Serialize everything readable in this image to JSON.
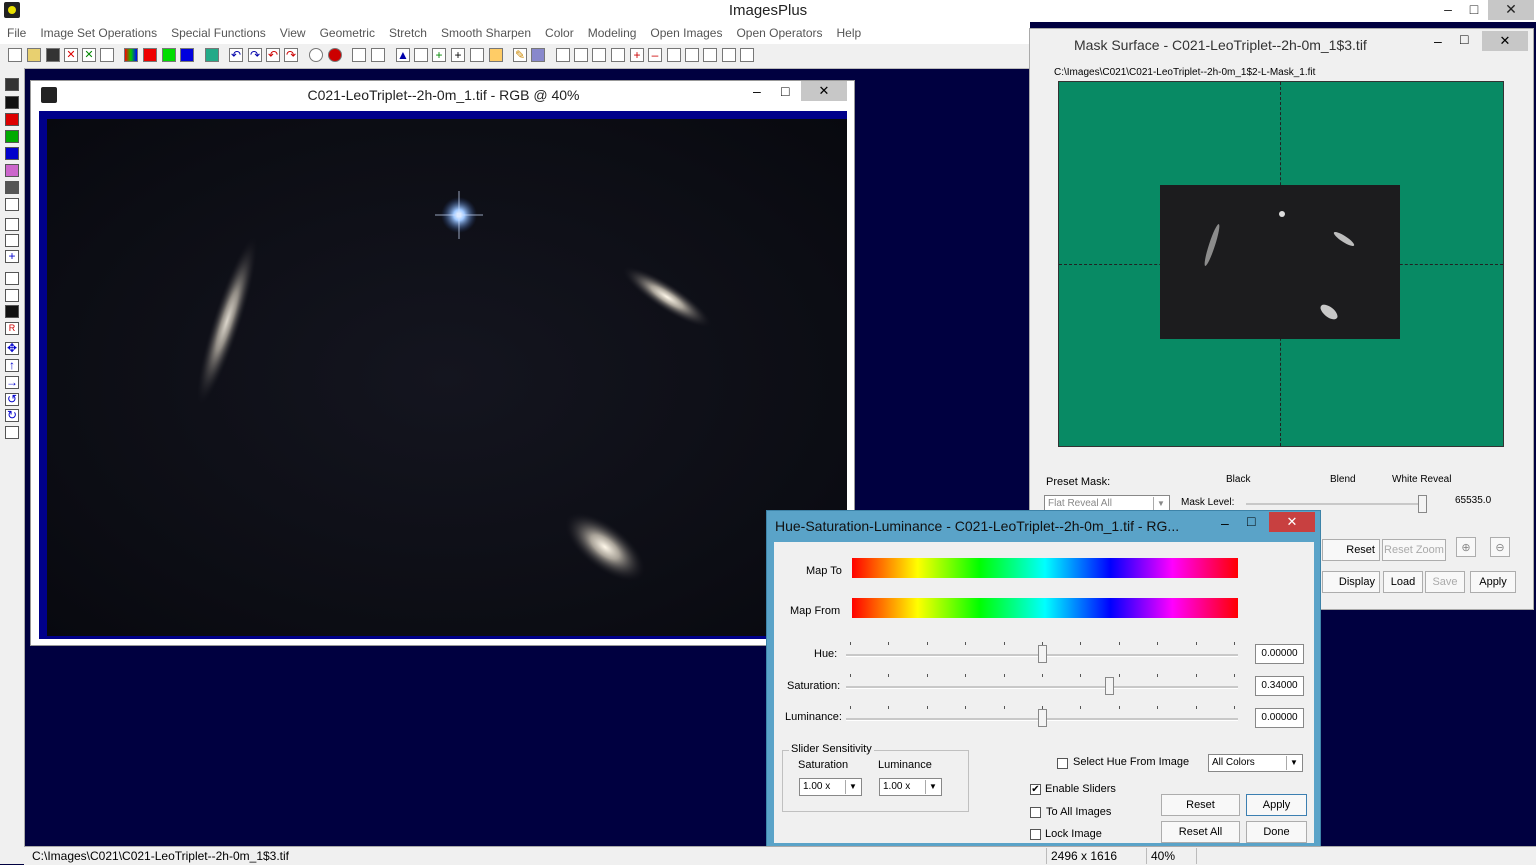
{
  "app": {
    "title": "ImagesPlus"
  },
  "menu": [
    "File",
    "Image Set Operations",
    "Special Functions",
    "View",
    "Geometric",
    "Stretch",
    "Smooth Sharpen",
    "Color",
    "Modeling",
    "Open Images",
    "Open Operators",
    "Help"
  ],
  "image_window": {
    "title": "C021-LeoTriplet--2h-0m_1.tif - RGB @ 40%"
  },
  "mask_window": {
    "title": "Mask Surface - C021-LeoTriplet--2h-0m_1$3.tif",
    "path": "C:\\Images\\C021\\C021-LeoTriplet--2h-0m_1$2-L-Mask_1.fit",
    "preset_label": "Preset Mask:",
    "preset_value": "Flat Reveal All",
    "black_label": "Black",
    "blend_label": "Blend",
    "white_label": "White Reveal",
    "mask_level_label": "Mask Level:",
    "mask_level_value": "65535.0",
    "mask_level_fraction": 1.0,
    "buttons": {
      "reset_mask": "Reset Mask",
      "reset_zoom": "Reset Zoom",
      "display_mask": "Display Mask",
      "load": "Load",
      "save": "Save",
      "apply": "Apply"
    }
  },
  "hsl_dialog": {
    "title": "Hue-Saturation-Luminance - C021-LeoTriplet--2h-0m_1.tif - RG...",
    "map_to": "Map To",
    "map_from": "Map From",
    "hue": {
      "label": "Hue:",
      "value": "0.00000",
      "fraction": 0.5
    },
    "saturation": {
      "label": "Saturation:",
      "value": "0.34000",
      "fraction": 0.67
    },
    "luminance": {
      "label": "Luminance:",
      "value": "0.00000",
      "fraction": 0.5
    },
    "sensitivity": {
      "group": "Slider Sensitivity",
      "saturation_label": "Saturation",
      "luminance_label": "Luminance",
      "saturation_value": "1.00 x",
      "luminance_value": "1.00 x"
    },
    "select_hue_label": "Select Hue From Image",
    "colors_value": "All Colors",
    "enable_sliders": {
      "label": "Enable Sliders",
      "checked": true
    },
    "to_all_images": {
      "label": "To All Images",
      "checked": false
    },
    "lock_image": {
      "label": "Lock Image",
      "checked": false
    },
    "buttons": {
      "reset": "Reset",
      "apply": "Apply",
      "reset_all": "Reset All",
      "done": "Done"
    }
  },
  "status": {
    "path": "C:\\Images\\C021\\C021-LeoTriplet--2h-0m_1$3.tif",
    "dimensions": "2496 x 1616",
    "zoom": "40%"
  }
}
